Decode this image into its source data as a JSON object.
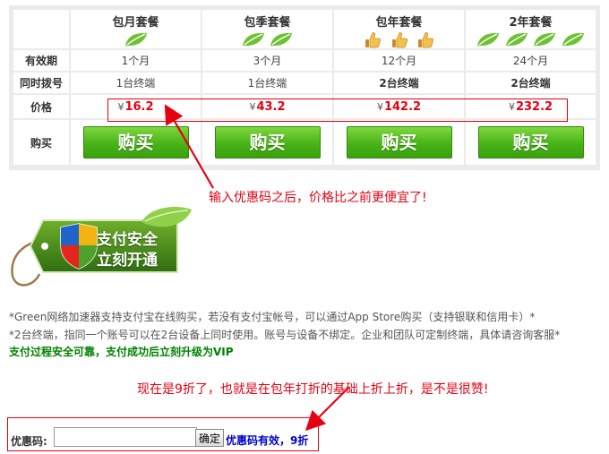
{
  "plans": [
    {
      "name": "包月套餐",
      "icon": "leaf-icon",
      "icon_count": 1,
      "period": "1个月",
      "devices": "1台终端",
      "devices_bold": false,
      "currency": "¥",
      "price": "16.2"
    },
    {
      "name": "包季套餐",
      "icon": "leaf-icon",
      "icon_count": 2,
      "period": "3个月",
      "devices": "1台终端",
      "devices_bold": false,
      "currency": "¥",
      "price": "43.2"
    },
    {
      "name": "包年套餐",
      "icon": "thumbs-up-icon",
      "icon_count": 3,
      "period": "12个月",
      "devices": "2台终端",
      "devices_bold": true,
      "currency": "¥",
      "price": "142.2"
    },
    {
      "name": "2年套餐",
      "icon": "leaf-icon",
      "icon_count": 4,
      "period": "24个月",
      "devices": "2台终端",
      "devices_bold": true,
      "currency": "¥",
      "price": "232.2"
    }
  ],
  "row_labels": {
    "period": "有效期",
    "devices": "同时拨号",
    "price": "价格",
    "buy": "购买"
  },
  "buy_label": "购买",
  "annotations": {
    "price_note": "输入优惠码之后，价格比之前更便宜了!",
    "discount_note": "现在是9折了，也就是在包年打折的基础上折上折，是不是很赞!"
  },
  "badge": {
    "line1": "支付安全",
    "line2": "立刻开通"
  },
  "info": {
    "line1": "*Green网络加速器支持支付宝在线购买，若没有支付宝帐号，可以通过App Store购买（支持银联和信用卡）*",
    "line2": "*2台终端，指同一个账号可以在2台设备上同时使用。账号与设备不绑定。企业和团队可定制终端，具体请咨询客服*",
    "line3": "支付过程安全可靠，支付成功后立刻升级为VIP"
  },
  "coupon": {
    "label": "优惠码:",
    "value": "",
    "placeholder": "",
    "button": "确定",
    "status": "优惠码有效，9折"
  },
  "colors": {
    "accent_red": "#e60012",
    "buy_green": "#48b317",
    "info_green": "#008000",
    "status_blue": "#0000cc",
    "leaf_green": "#6cc230"
  }
}
